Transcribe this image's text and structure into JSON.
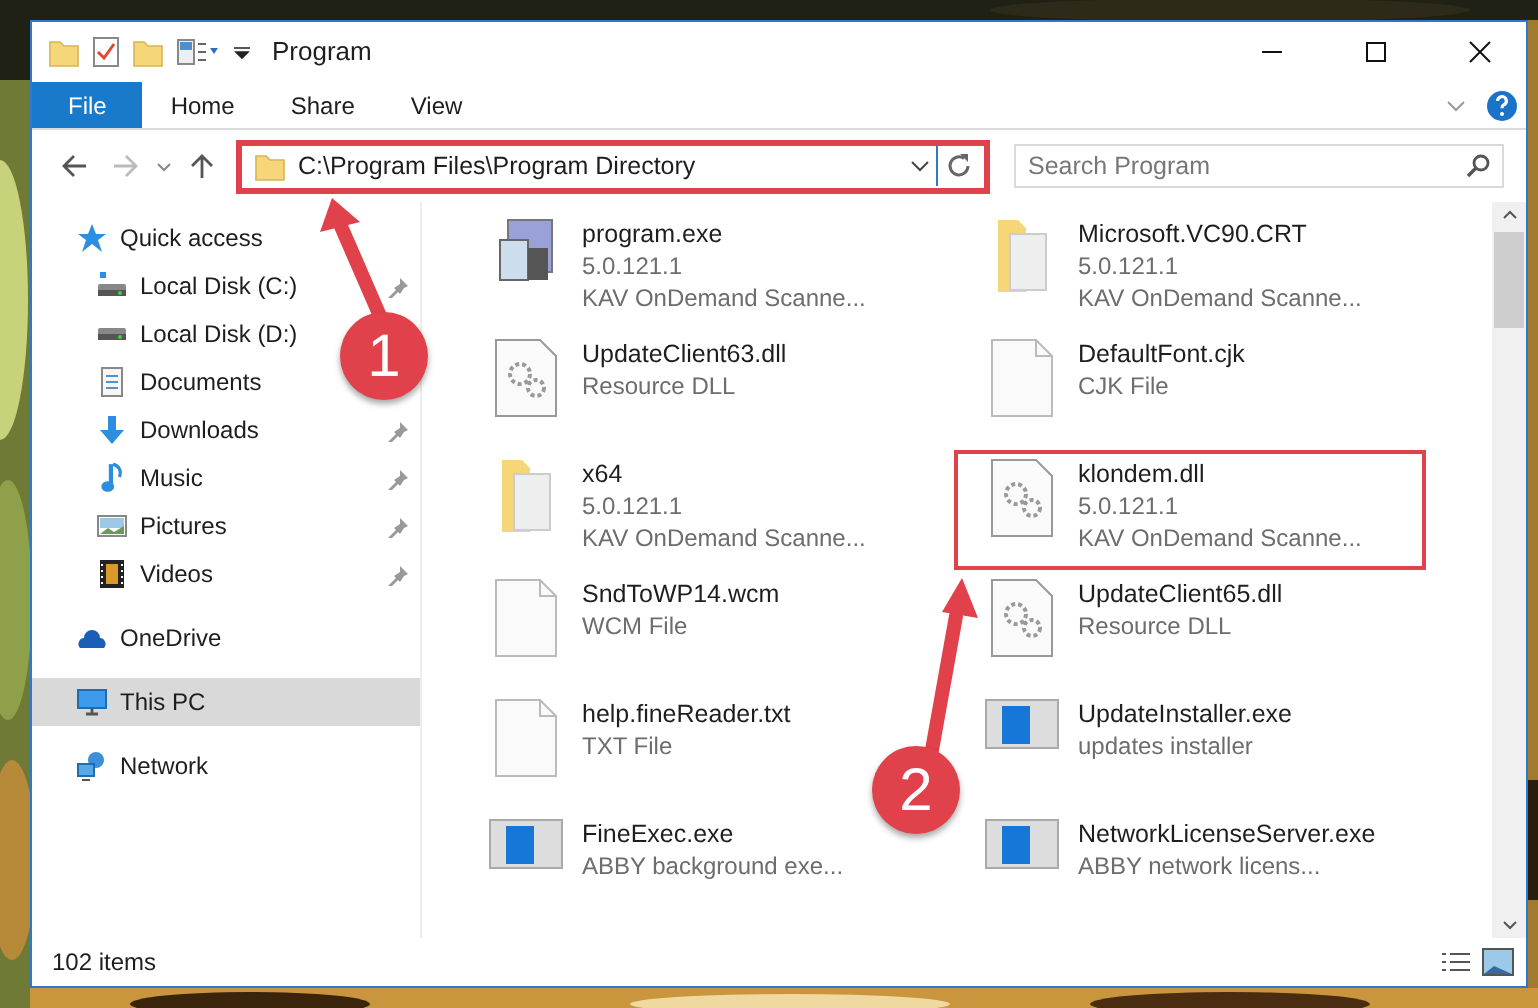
{
  "window": {
    "title": "Program"
  },
  "ribbon": {
    "tabs": [
      {
        "label": "File",
        "kind": "file-menu"
      },
      {
        "label": "Home",
        "kind": "tab"
      },
      {
        "label": "Share",
        "kind": "tab"
      },
      {
        "label": "View",
        "kind": "tab"
      }
    ]
  },
  "address_bar": {
    "path": "C:\\Program Files\\Program Directory",
    "highlighted": true
  },
  "search": {
    "placeholder": "Search Program"
  },
  "sidebar": {
    "items": [
      {
        "label": "Quick access",
        "selected": false,
        "children": [
          {
            "label": "Local Disk (C:)",
            "pinned": true
          },
          {
            "label": "Local Disk (D:)",
            "pinned": false
          },
          {
            "label": "Documents",
            "pinned": false
          },
          {
            "label": "Downloads",
            "pinned": true
          },
          {
            "label": "Music",
            "pinned": true
          },
          {
            "label": "Pictures",
            "pinned": true
          },
          {
            "label": "Videos",
            "pinned": true
          }
        ]
      },
      {
        "label": "OneDrive",
        "selected": false
      },
      {
        "label": "This PC",
        "selected": true
      },
      {
        "label": "Network",
        "selected": false
      }
    ]
  },
  "files": [
    {
      "kind": "exe",
      "lines": [
        "program.exe",
        "5.0.121.1",
        "KAV OnDemand Scanne..."
      ],
      "highlighted": false
    },
    {
      "kind": "folder",
      "lines": [
        "Microsoft.VC90.CRT",
        "5.0.121.1",
        "KAV OnDemand Scanne..."
      ],
      "highlighted": false
    },
    {
      "kind": "dll",
      "lines": [
        "UpdateClient63.dll",
        "Resource DLL"
      ],
      "highlighted": false
    },
    {
      "kind": "blank",
      "lines": [
        "DefaultFont.cjk",
        "CJK File"
      ],
      "highlighted": false
    },
    {
      "kind": "folder",
      "lines": [
        "x64",
        "5.0.121.1",
        "KAV OnDemand Scanne..."
      ],
      "highlighted": false
    },
    {
      "kind": "dll",
      "lines": [
        "klondem.dll",
        "5.0.121.1",
        "KAV OnDemand Scanne..."
      ],
      "highlighted": true
    },
    {
      "kind": "blank",
      "lines": [
        "SndToWP14.wcm",
        "WCM File"
      ],
      "highlighted": false
    },
    {
      "kind": "dll",
      "lines": [
        "UpdateClient65.dll",
        "Resource DLL"
      ],
      "highlighted": false
    },
    {
      "kind": "blank",
      "lines": [
        "help.fineReader.txt",
        "TXT File"
      ],
      "highlighted": false
    },
    {
      "kind": "app",
      "lines": [
        "UpdateInstaller.exe",
        "updates installer"
      ],
      "highlighted": false
    },
    {
      "kind": "app",
      "lines": [
        "FineExec.exe",
        "ABBY background exe..."
      ],
      "highlighted": false
    },
    {
      "kind": "app",
      "lines": [
        "NetworkLicenseServer.exe",
        "ABBY network licens..."
      ],
      "highlighted": false
    }
  ],
  "status_bar": {
    "text": "102 items"
  },
  "callouts": [
    {
      "label": "1"
    },
    {
      "label": "2"
    }
  ]
}
